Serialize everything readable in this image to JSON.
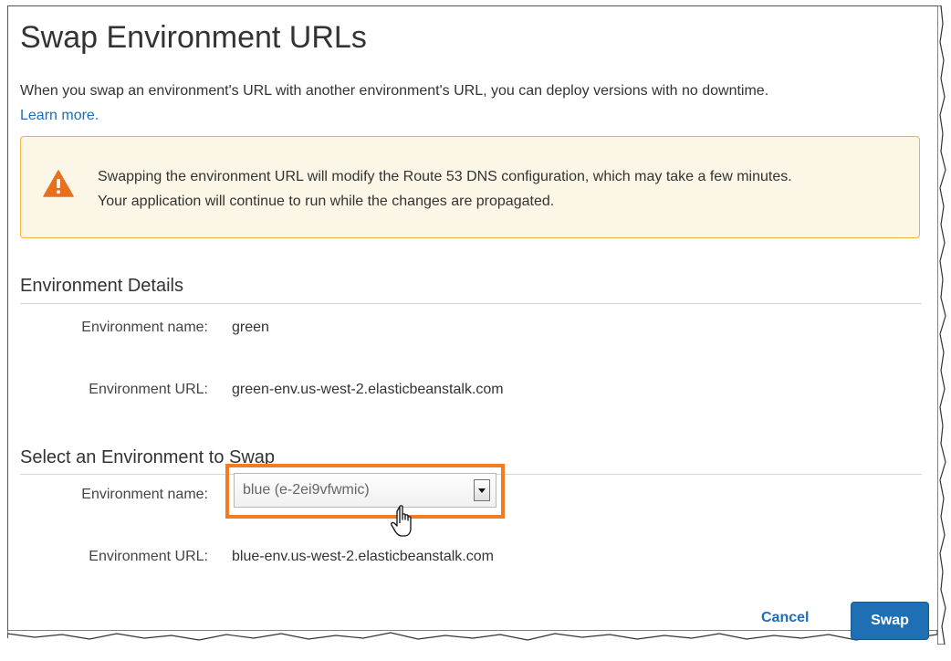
{
  "dialog": {
    "title": "Swap Environment URLs",
    "intro_text": "When you swap an environment's URL with another environment's URL, you can deploy versions with no downtime.",
    "learn_more": "Learn more."
  },
  "alert": {
    "icon": "warning-icon",
    "line1": "Swapping the environment URL will modify the Route 53 DNS configuration, which may take a few minutes.",
    "line2": "Your application will continue to run while the changes are propagated.",
    "colors": {
      "background": "#fcf6e6",
      "border": "#f0b23e",
      "icon": "#e8701c"
    }
  },
  "environment_details": {
    "heading": "Environment Details",
    "name_label": "Environment name:",
    "name_value": "green",
    "url_label": "Environment URL:",
    "url_value": "green-env.us-west-2.elasticbeanstalk.com"
  },
  "swap_target": {
    "heading": "Select an Environment to Swap",
    "name_label": "Environment name:",
    "selected_option": "blue (e-2ei9vfwmic)",
    "url_label": "Environment URL:",
    "url_value": "blue-env.us-west-2.elasticbeanstalk.com",
    "highlight_color": "#f47b20"
  },
  "actions": {
    "cancel_label": "Cancel",
    "swap_label": "Swap",
    "primary_color": "#1f6fb5",
    "link_color": "#1a6ec0"
  }
}
